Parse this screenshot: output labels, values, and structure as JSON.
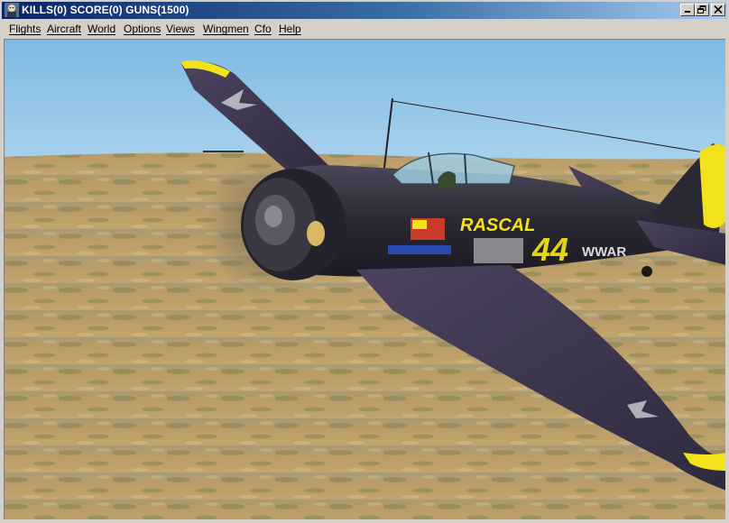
{
  "window": {
    "title": "KILLS(0) SCORE(0) GUNS(1500)",
    "controls": {
      "minimize": "_",
      "restore": "restore",
      "close": "×"
    }
  },
  "menu": [
    {
      "label": "Flights"
    },
    {
      "label": "Aircraft"
    },
    {
      "label": "World"
    },
    {
      "label": "Options"
    },
    {
      "label": "Views"
    },
    {
      "label": "Wingmen"
    },
    {
      "label": "Cfo"
    },
    {
      "label": "Help"
    }
  ],
  "aircraft": {
    "nose_art": "RASCAL",
    "number": "44",
    "tail_text": "WWAR",
    "colors": {
      "fuselage": "#2c2a3a",
      "accent": "#f2e21a",
      "wing": "#3a3350"
    }
  },
  "scene": {
    "sky_color": "#8ec3e6",
    "ground_color": "#b49a66"
  },
  "icons": [
    "app-icon",
    "minimize-icon",
    "restore-icon",
    "close-icon"
  ]
}
